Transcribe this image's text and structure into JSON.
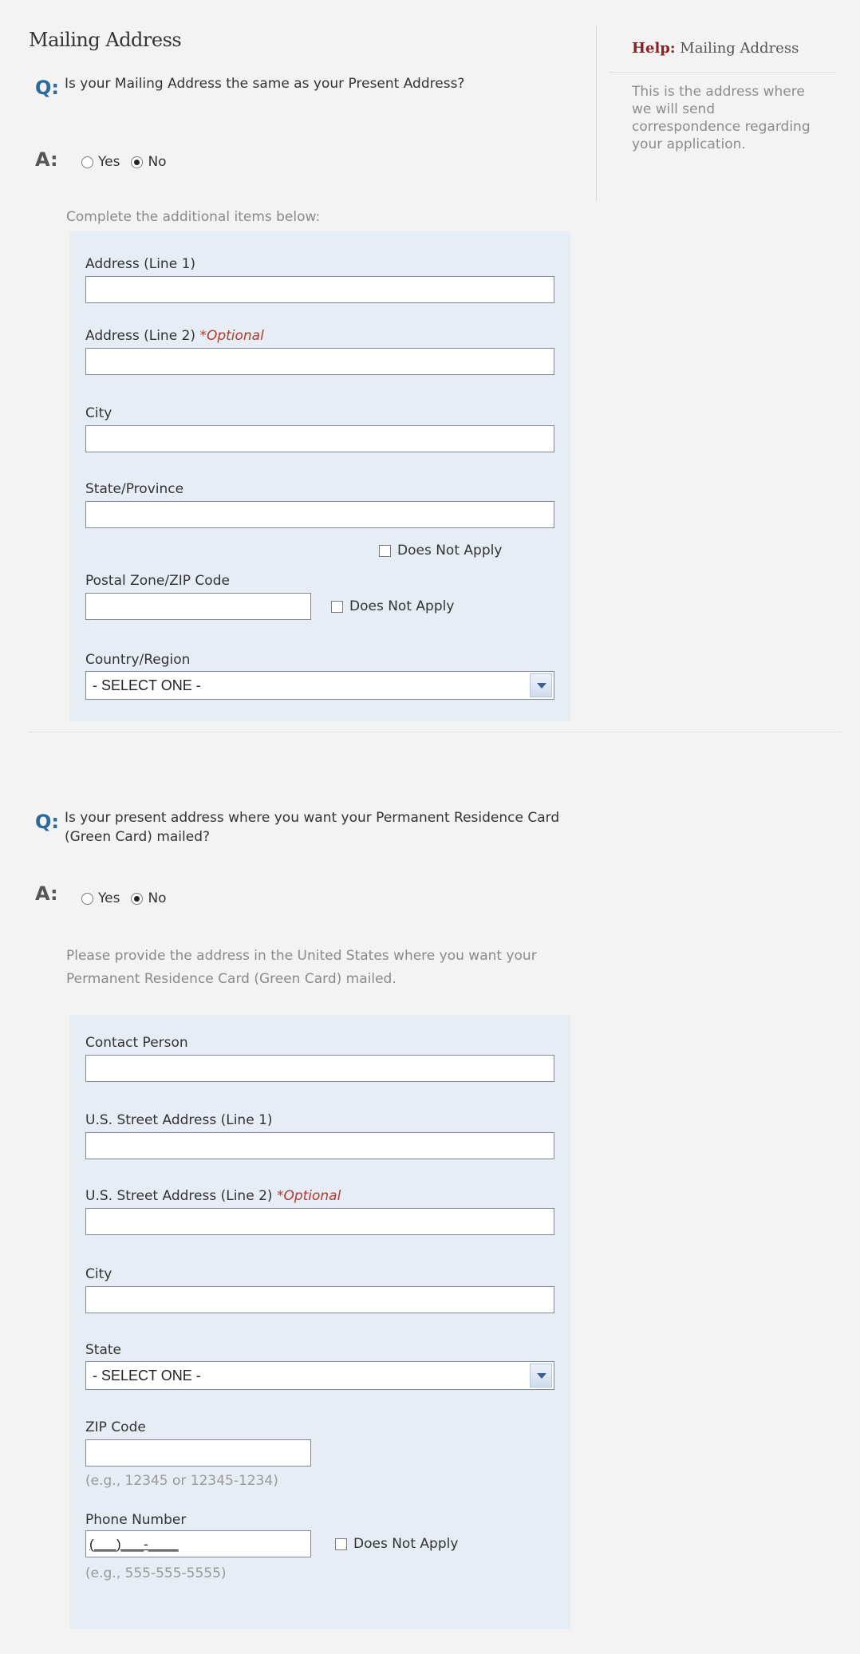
{
  "section": {
    "title": "Mailing Address"
  },
  "help": {
    "label": "Help:",
    "topic": "Mailing Address",
    "text": "This is the address where we will send correspondence regarding your application."
  },
  "markers": {
    "question": "Q:",
    "answer": "A:"
  },
  "mailing_question": {
    "text": "Is your Mailing Address the same as your Present Address?",
    "options": [
      {
        "label": "Yes",
        "checked": false
      },
      {
        "label": "No",
        "checked": true
      }
    ],
    "instruction": "Complete the additional items below:"
  },
  "mailing_form": {
    "address1_label": "Address (Line 1)",
    "address2_label": "Address (Line 2)",
    "optional_label": "*Optional",
    "city_label": "City",
    "state_label": "State/Province",
    "does_not_apply": "Does Not Apply",
    "postal_label": "Postal Zone/ZIP Code",
    "country_label": "Country/Region",
    "country_value": "- SELECT ONE -"
  },
  "card_question": {
    "text": "Is your present address where you want your Permanent Residence Card (Green Card) mailed?",
    "options": [
      {
        "label": "Yes",
        "checked": false
      },
      {
        "label": "No",
        "checked": true
      }
    ],
    "instruction": "Please provide the address in the United States where you want your Permanent Residence Card (Green Card) mailed."
  },
  "us_form": {
    "contact_label": "Contact Person",
    "street1_label": "U.S. Street Address (Line 1)",
    "street2_label": "U.S. Street Address (Line 2)",
    "optional_label": "*Optional",
    "city_label": "City",
    "state_label": "State",
    "state_value": "- SELECT ONE -",
    "zip_label": "ZIP Code",
    "zip_hint": "(e.g., 12345 or 12345-1234)",
    "phone_label": "Phone Number",
    "phone_mask": "(___)___-____",
    "does_not_apply": "Does Not Apply",
    "phone_hint": "(e.g., 555-555-5555)"
  }
}
